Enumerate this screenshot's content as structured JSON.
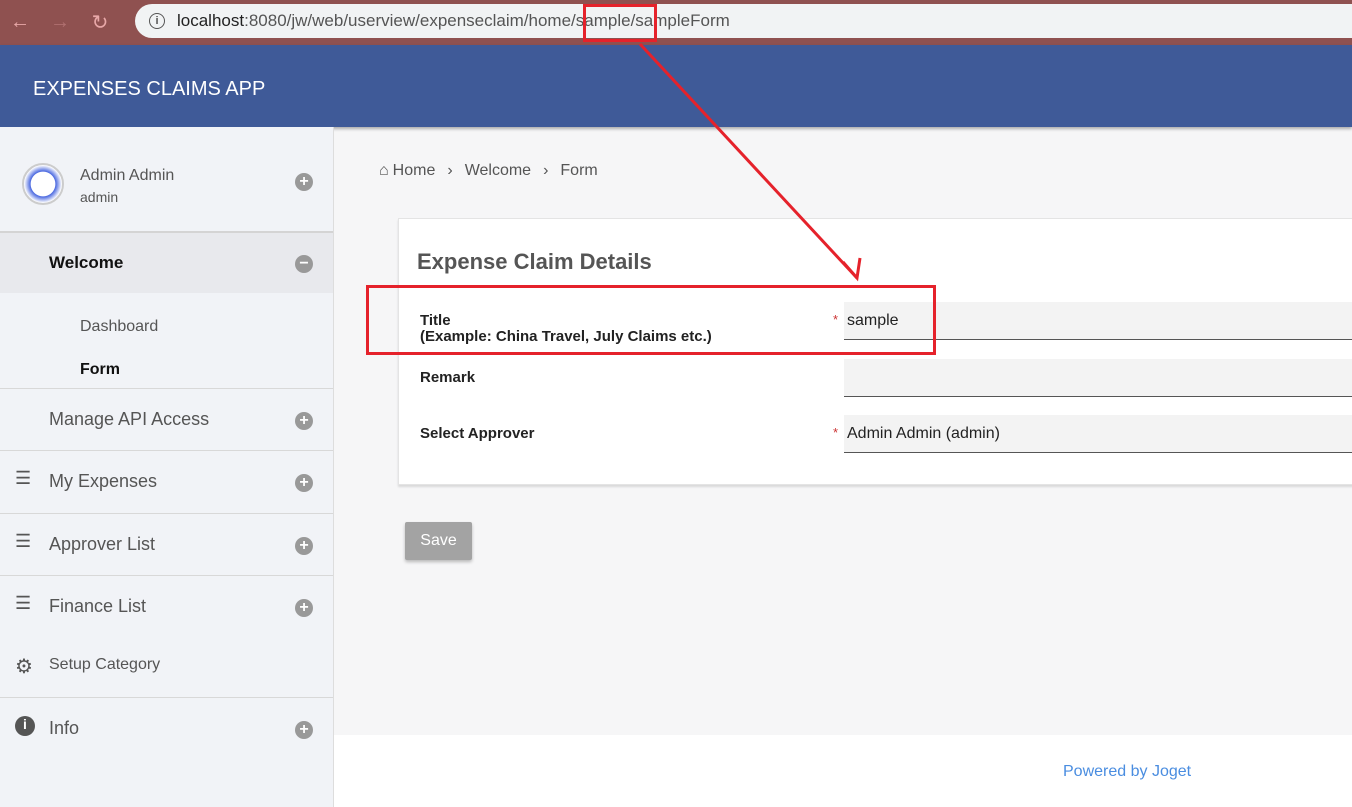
{
  "browser": {
    "url_host": "localhost",
    "url_path": ":8080/jw/web/userview/expenseclaim/home/sample/sampleForm"
  },
  "header": {
    "title": "EXPENSES CLAIMS APP"
  },
  "profile": {
    "name": "Admin Admin",
    "username": "admin"
  },
  "sidebar": {
    "items": [
      {
        "label": "Welcome",
        "sub": [
          "Dashboard",
          "Form"
        ]
      },
      {
        "label": "Manage API Access"
      },
      {
        "label": "My Expenses"
      },
      {
        "label": "Approver List"
      },
      {
        "label": "Finance List"
      },
      {
        "label": "Setup Category"
      },
      {
        "label": "Info"
      }
    ]
  },
  "breadcrumb": [
    "Home",
    "Welcome",
    "Form"
  ],
  "form": {
    "title": "Expense Claim Details",
    "fields": [
      {
        "label": "Title",
        "hint": "(Example: China Travel, July Claims etc.)",
        "value": "sample",
        "required": "*"
      },
      {
        "label": "Remark",
        "value": ""
      },
      {
        "label": "Select Approver",
        "value": "Admin Admin (admin)",
        "required": "*"
      }
    ],
    "save_label": "Save"
  },
  "footer": {
    "powered": "Powered by Joget"
  },
  "colors": {
    "header": "#3f5a98",
    "annotation": "#e5222b"
  }
}
